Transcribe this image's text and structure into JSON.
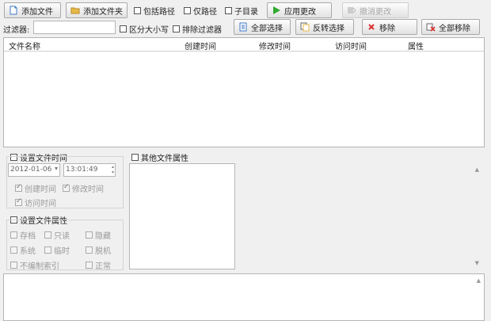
{
  "toolbar": {
    "add_file": "添加文件",
    "add_folder": "添加文件夹",
    "include_path": "包括路径",
    "path_only": "仅路径",
    "subdir": "子目录",
    "apply": "应用更改",
    "undo": "撤消更改"
  },
  "filter": {
    "label": "过滤器:",
    "value": "",
    "case_sensitive": "区分大小写",
    "exclude_filter": "排除过滤器",
    "select_all": "全部选择",
    "invert_select": "反转选择",
    "remove": "移除",
    "remove_all": "全部移除"
  },
  "file_list": {
    "columns": [
      "文件名称",
      "创建时间",
      "修改时间",
      "访问时间",
      "属性"
    ]
  },
  "file_time": {
    "title": "设置文件时间",
    "date": "2012-01-06",
    "time": "13:01:49",
    "created": "创建时间",
    "modified": "修改时间",
    "accessed": "访问时间"
  },
  "file_attr": {
    "title": "设置文件属性",
    "archive": "存档",
    "readonly": "只读",
    "hidden": "隐藏",
    "system": "系统",
    "temporary": "临时",
    "offline": "脱机",
    "not_indexed": "不编制索引",
    "normal": "正常"
  },
  "other_attr": {
    "title": "其他文件属性"
  },
  "colors": {
    "add_icon": "#3d79c7",
    "folder_icon": "#e8b84a",
    "apply_icon": "#2eaa2e",
    "remove_icon": "#d93030"
  }
}
